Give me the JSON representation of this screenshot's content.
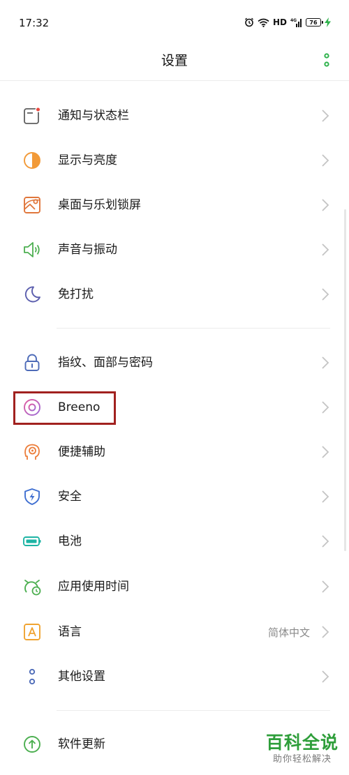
{
  "status_bar": {
    "time": "17:32",
    "network": "HD",
    "signal": "4G",
    "battery": "76"
  },
  "header": {
    "title": "设置"
  },
  "colors": {
    "notification": "#5f5f5f",
    "display": "#f29a38",
    "wallpaper": "#e0763b",
    "sound": "#4caf50",
    "dnd": "#5c5fae",
    "lock": "#4d6bb8",
    "breeno": "#c963a8",
    "assist": "#ec7d3a",
    "security": "#3f6fd1",
    "battery": "#1db4a4",
    "usage": "#4caf50",
    "language": "#f0a330",
    "other": "#4d6bb8",
    "update": "#4caf50",
    "highlight": "#a1211f",
    "watermark": "#2e9e3a"
  },
  "items": [
    {
      "label": "通知与状态栏",
      "icon": "notification-icon"
    },
    {
      "label": "显示与亮度",
      "icon": "display-icon"
    },
    {
      "label": "桌面与乐划锁屏",
      "icon": "wallpaper-icon"
    },
    {
      "label": "声音与振动",
      "icon": "sound-icon"
    },
    {
      "label": "免打扰",
      "icon": "moon-icon"
    },
    {
      "label": "指纹、面部与密码",
      "icon": "lock-icon"
    },
    {
      "label": "Breeno",
      "icon": "breeno-icon"
    },
    {
      "label": "便捷辅助",
      "icon": "assist-icon"
    },
    {
      "label": "安全",
      "icon": "shield-icon"
    },
    {
      "label": "电池",
      "icon": "battery-icon"
    },
    {
      "label": "应用使用时间",
      "icon": "app-usage-icon"
    },
    {
      "label": "语言",
      "icon": "language-icon",
      "value": "简体中文"
    },
    {
      "label": "其他设置",
      "icon": "other-settings-icon"
    },
    {
      "label": "软件更新",
      "icon": "update-icon"
    }
  ],
  "watermark": {
    "title": "百科全说",
    "subtitle": "助你轻松解决"
  }
}
